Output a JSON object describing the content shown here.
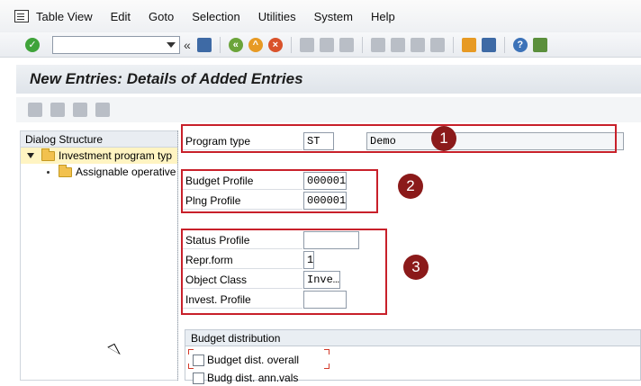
{
  "menu": [
    "Table View",
    "Edit",
    "Goto",
    "Selection",
    "Utilities",
    "System",
    "Help"
  ],
  "toolbar": {
    "command_value": "",
    "back_symbol": "«"
  },
  "title": "New Entries: Details of Added Entries",
  "dialog": {
    "header": "Dialog Structure",
    "items": [
      {
        "label": "Investment program typ",
        "selected": true
      },
      {
        "label": "Assignable operative"
      }
    ]
  },
  "form": {
    "program_type": {
      "label": "Program type",
      "value": "ST",
      "desc": "Demo"
    },
    "budget_profile": {
      "label": "Budget Profile",
      "value": "000001"
    },
    "plng_profile": {
      "label": "Plng Profile",
      "value": "000001"
    },
    "status_profile": {
      "label": "Status Profile",
      "value": ""
    },
    "repr_form": {
      "label": "Repr.form",
      "value": "1"
    },
    "object_class": {
      "label": "Object Class",
      "value": "Inve…"
    },
    "invest_profile": {
      "label": "Invest. Profile",
      "value": ""
    }
  },
  "badges": [
    "1",
    "2",
    "3"
  ],
  "budget_distribution": {
    "title": "Budget distribution",
    "overall": "Budget dist. overall",
    "annual": "Budg dist. ann.vals"
  },
  "colors": {
    "annotation_red": "#c8202a",
    "badge": "#8b1a1a",
    "selected_row": "#fff4c2"
  }
}
